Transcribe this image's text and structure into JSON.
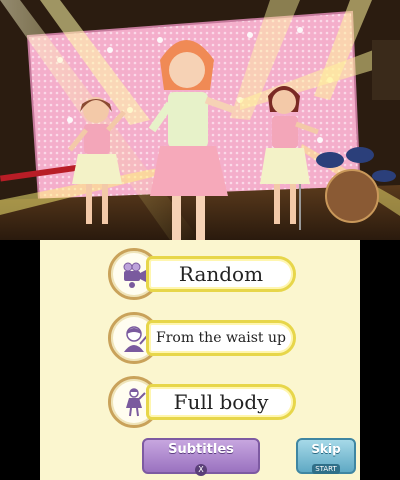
{
  "scene": {
    "description_colors": {
      "backdrop": "#f2a6c6",
      "floor": "#3a2615"
    }
  },
  "menu": {
    "options": [
      {
        "label": "Random",
        "icon": "random-camera-icon"
      },
      {
        "label": "From the waist up",
        "icon": "waist-up-icon"
      },
      {
        "label": "Full body",
        "icon": "full-body-icon"
      }
    ]
  },
  "buttons": {
    "subtitles": {
      "label": "Subtitles",
      "key": "X"
    },
    "skip": {
      "label": "Skip",
      "key": "START"
    }
  }
}
